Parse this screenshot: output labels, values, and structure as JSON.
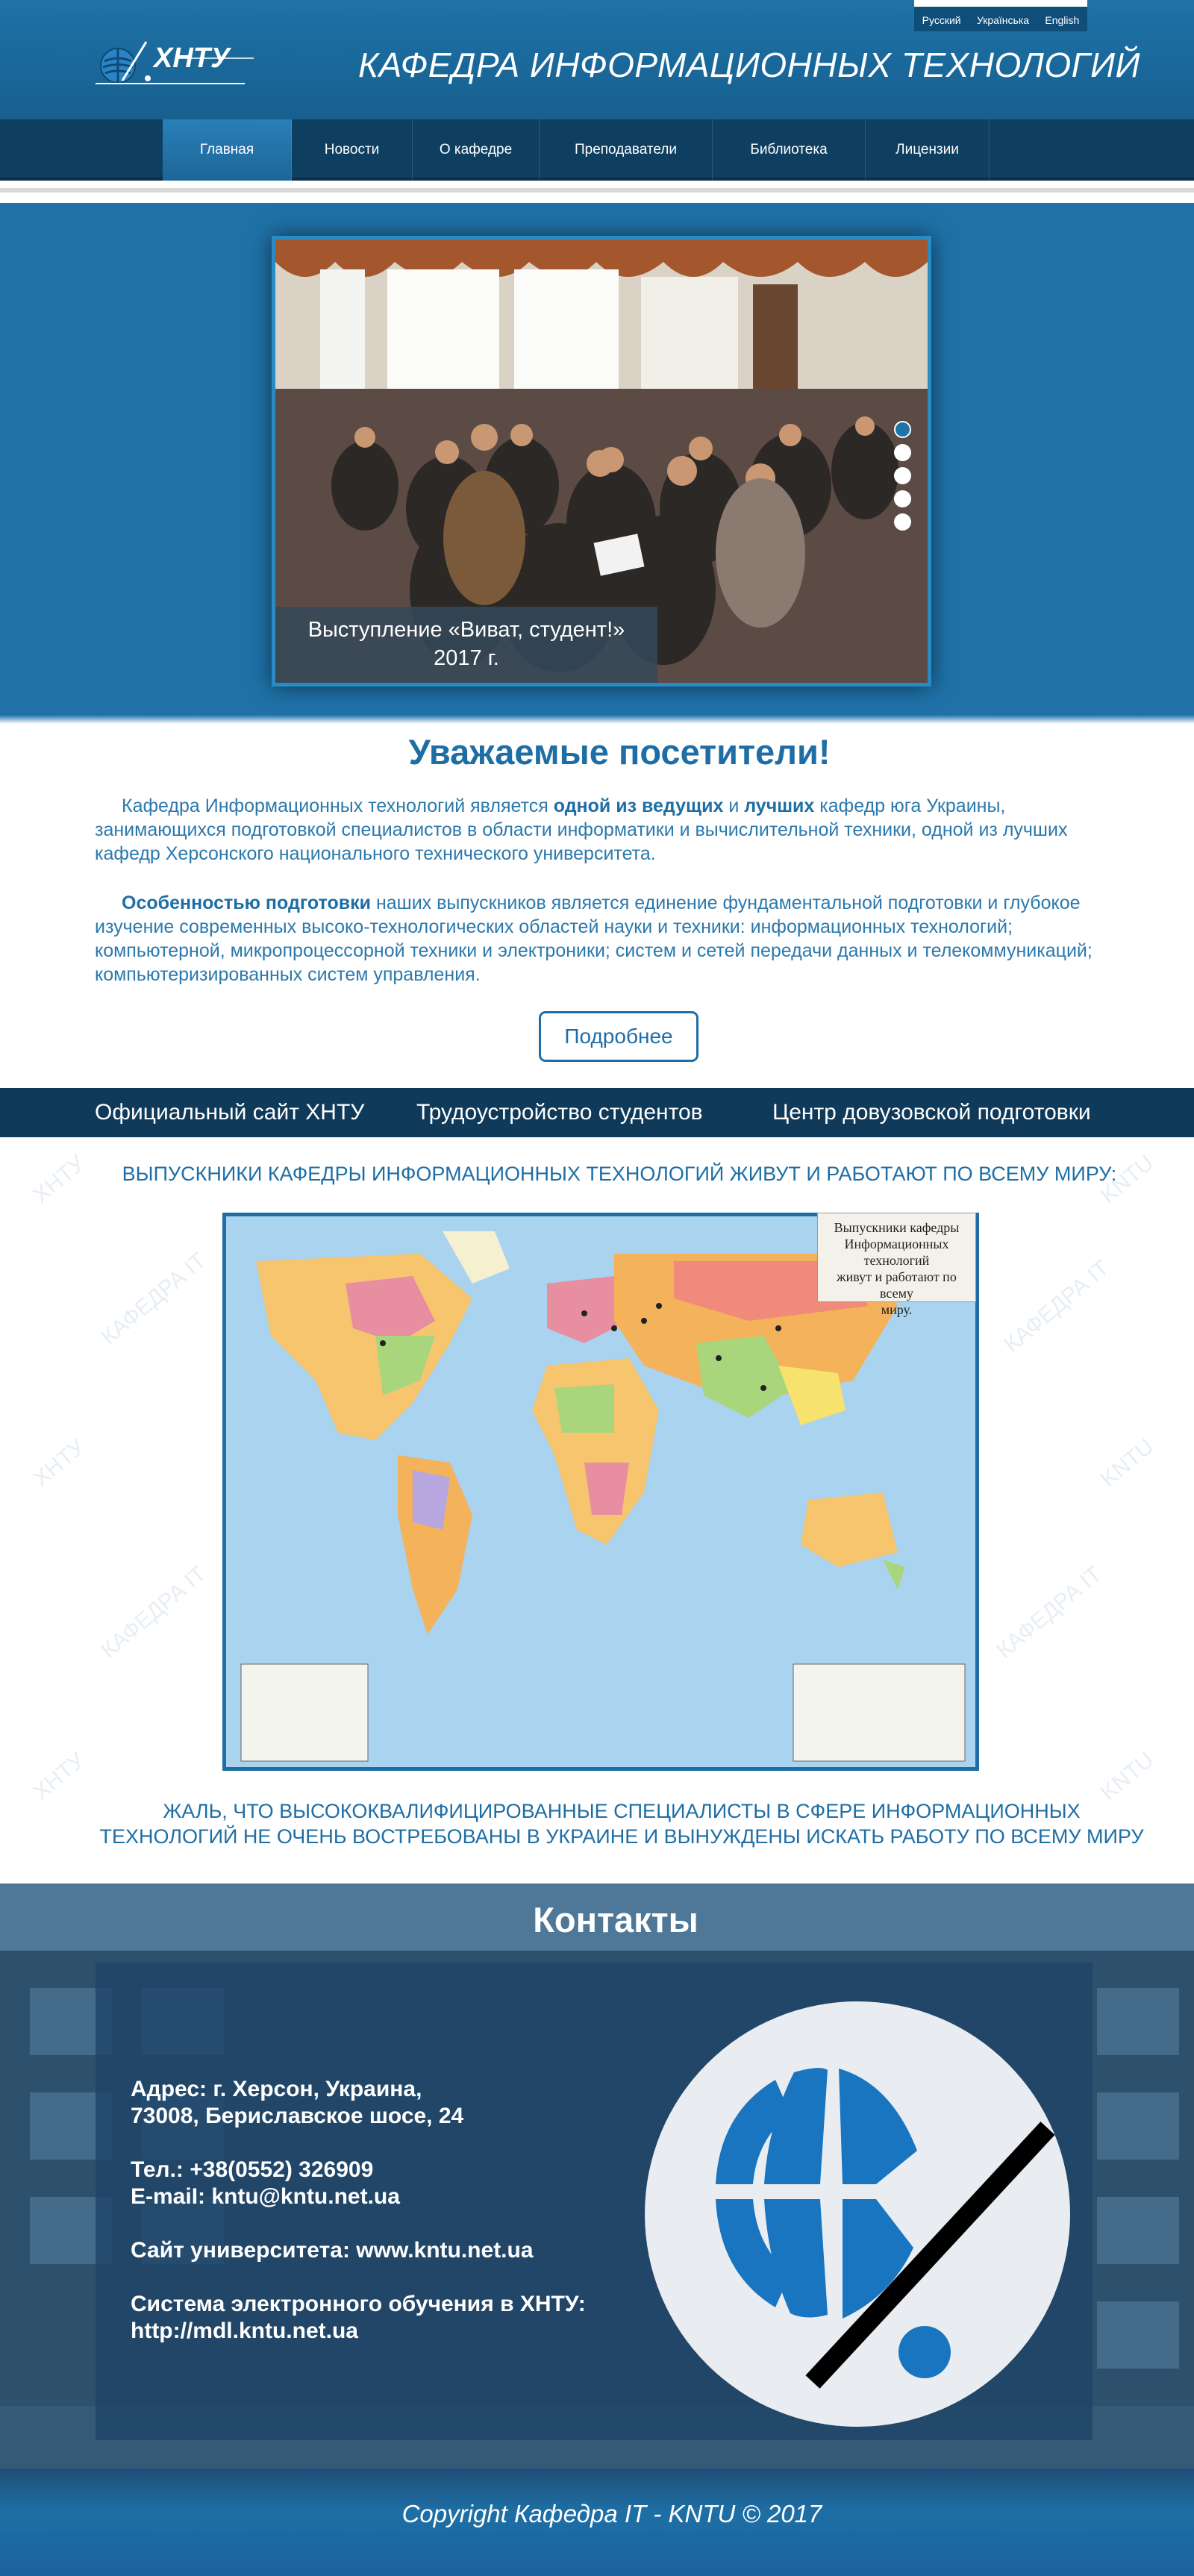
{
  "languages": [
    "Русский",
    "Українська",
    "English"
  ],
  "header": {
    "logo_text": "ХНТУ",
    "title": "КАФЕДРА ИНФОРМАЦИОННЫХ ТЕХНОЛОГИЙ"
  },
  "nav": {
    "items": [
      "Главная",
      "Новости",
      "О кафедре",
      "Преподаватели",
      "Библиотека",
      "Лицензии"
    ],
    "active": 0
  },
  "slider": {
    "caption_line1": "Выступление «Виват, студент!»",
    "caption_line2": "2017 г.",
    "slide_count": 5,
    "active_slide": 0
  },
  "welcome": {
    "title": "Уважаемые посетители!",
    "p1_part1": "Кафедра Информационных технологий является ",
    "p1_bold1": "одной из ведущих",
    "p1_part2": " и ",
    "p1_bold2": "лучших",
    "p1_part3": " кафедр юга Украины, занимающихся подготовкой специалистов в области информатики и вычислительной техники, одной из лучших кафедр Херсонского национального технического университета.",
    "p2_bold": "Особенностью подготовки",
    "p2_text": " наших выпускников является единение фундаментальной подготовки и глубокое изучение  современных высоко-технологических областей науки и техники: информационных технологий; компьютерной, микропроцессорной техники и электроники; систем и сетей передачи данных и телекоммуникаций; компьютеризированных систем управления.",
    "more_label": "Подробнее"
  },
  "links": [
    "Официальный сайт ХНТУ",
    "Трудоустройство студентов",
    "Центр довузовской подготовки"
  ],
  "map_section": {
    "heading": "ВЫПУСКНИКИ КАФЕДРЫ ИНФОРМАЦИОННЫХ ТЕХНОЛОГИЙ ЖИВУТ И РАБОТАЮТ ПО ВСЕМУ МИРУ:",
    "note_line1": "Выпускники кафедры",
    "note_line2": "Информационных технологий",
    "note_line3": "живут и работают по всему",
    "note_line4": "миру.",
    "subtext_line1": "ЖАЛЬ, ЧТО ВЫСОКОКВАЛИФИЦИРОВАННЫЕ СПЕЦИАЛИСТЫ В СФЕРЕ ИНФОРМАЦИОННЫХ",
    "subtext_line2": "ТЕХНОЛОГИЙ НЕ ОЧЕНЬ ВОСТРЕБОВАНЫ В УКРАИНЕ И ВЫНУЖДЕНЫ ИСКАТЬ РАБОТУ ПО ВСЕМУ МИРУ",
    "watermark_1": "ХНТУ",
    "watermark_2": "КАФЕДРА IT",
    "watermark_3": "KNTU"
  },
  "contacts": {
    "title": "Контакты",
    "address_line1": "Адрес: г. Херсон, Украина,",
    "address_line2": "73008, Бериславское шосе, 24",
    "phone": "Тел.: +38(0552) 326909",
    "email": "E-maiI: kntu@kntu.net.ua",
    "site": "Сайт университета: www.kntu.net.ua",
    "elearning_line1": "Система электронного обучения в ХНТУ:",
    "elearning_line2": "http://mdl.kntu.net.ua"
  },
  "footer": {
    "copyright": "Copyright Кафедра IT - KNTU © 2017"
  },
  "colors": {
    "brand_blue": "#1e72a8",
    "dark_navy": "#0f3a5a",
    "text_blue": "#1e6ea5"
  }
}
